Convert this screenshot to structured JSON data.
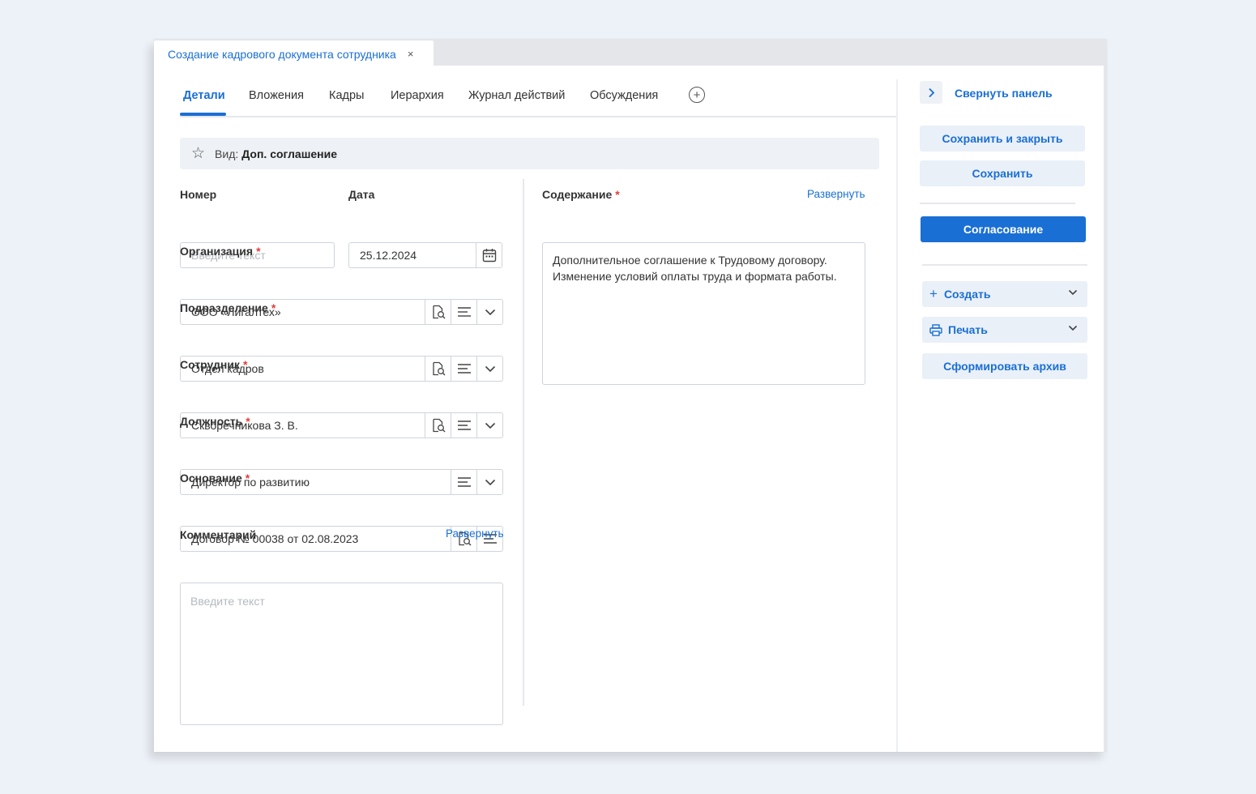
{
  "window": {
    "doc_tab_title": "Создание кадрового документа сотрудника",
    "close_glyph": "×"
  },
  "tabs": [
    {
      "label": "Детали",
      "active": true
    },
    {
      "label": "Вложения"
    },
    {
      "label": "Кадры"
    },
    {
      "label": "Иерархия"
    },
    {
      "label": "Журнал действий"
    },
    {
      "label": "Обсуждения"
    }
  ],
  "add_tab_glyph": "+",
  "kind": {
    "prefix": "Вид:",
    "value": "Доп. соглашение"
  },
  "form": {
    "number": {
      "label": "Номер",
      "placeholder": "Введите текст"
    },
    "date": {
      "label": "Дата",
      "value": "25.12.2024"
    },
    "organization": {
      "label": "Организация",
      "value": "ООО «Лигалтех»"
    },
    "department": {
      "label": "Подразделение",
      "value": "Отдел кадров"
    },
    "employee": {
      "label": "Сотрудник",
      "value": "Скворечникова З. В."
    },
    "position": {
      "label": "Должность",
      "value": "Директор по развитию"
    },
    "basis": {
      "label": "Основание",
      "value": "Договор № 00038 от 02.08.2023"
    },
    "comment": {
      "label": "Комментарий",
      "expand": "Развернуть",
      "placeholder": "Введите текст"
    },
    "content": {
      "label": "Содержание",
      "expand": "Развернуть",
      "text": "Дополнительное соглашение к Трудовому договору. Изменение условий оплаты труда и формата работы."
    },
    "required_mark": "*"
  },
  "sidebar": {
    "collapse": "Свернуть панель",
    "save_close": "Сохранить и закрыть",
    "save": "Сохранить",
    "approval": "Согласование",
    "create": "Создать",
    "print": "Печать",
    "archive": "Сформировать архив"
  },
  "colors": {
    "accent": "#1a6fd4",
    "required": "#e23d3d"
  },
  "icons": [
    "close-icon",
    "add-tab-icon",
    "star-icon",
    "calendar-icon",
    "lookup-icon",
    "list-icon",
    "chevron-down-icon",
    "chevron-right-icon",
    "plus-icon",
    "printer-icon"
  ]
}
